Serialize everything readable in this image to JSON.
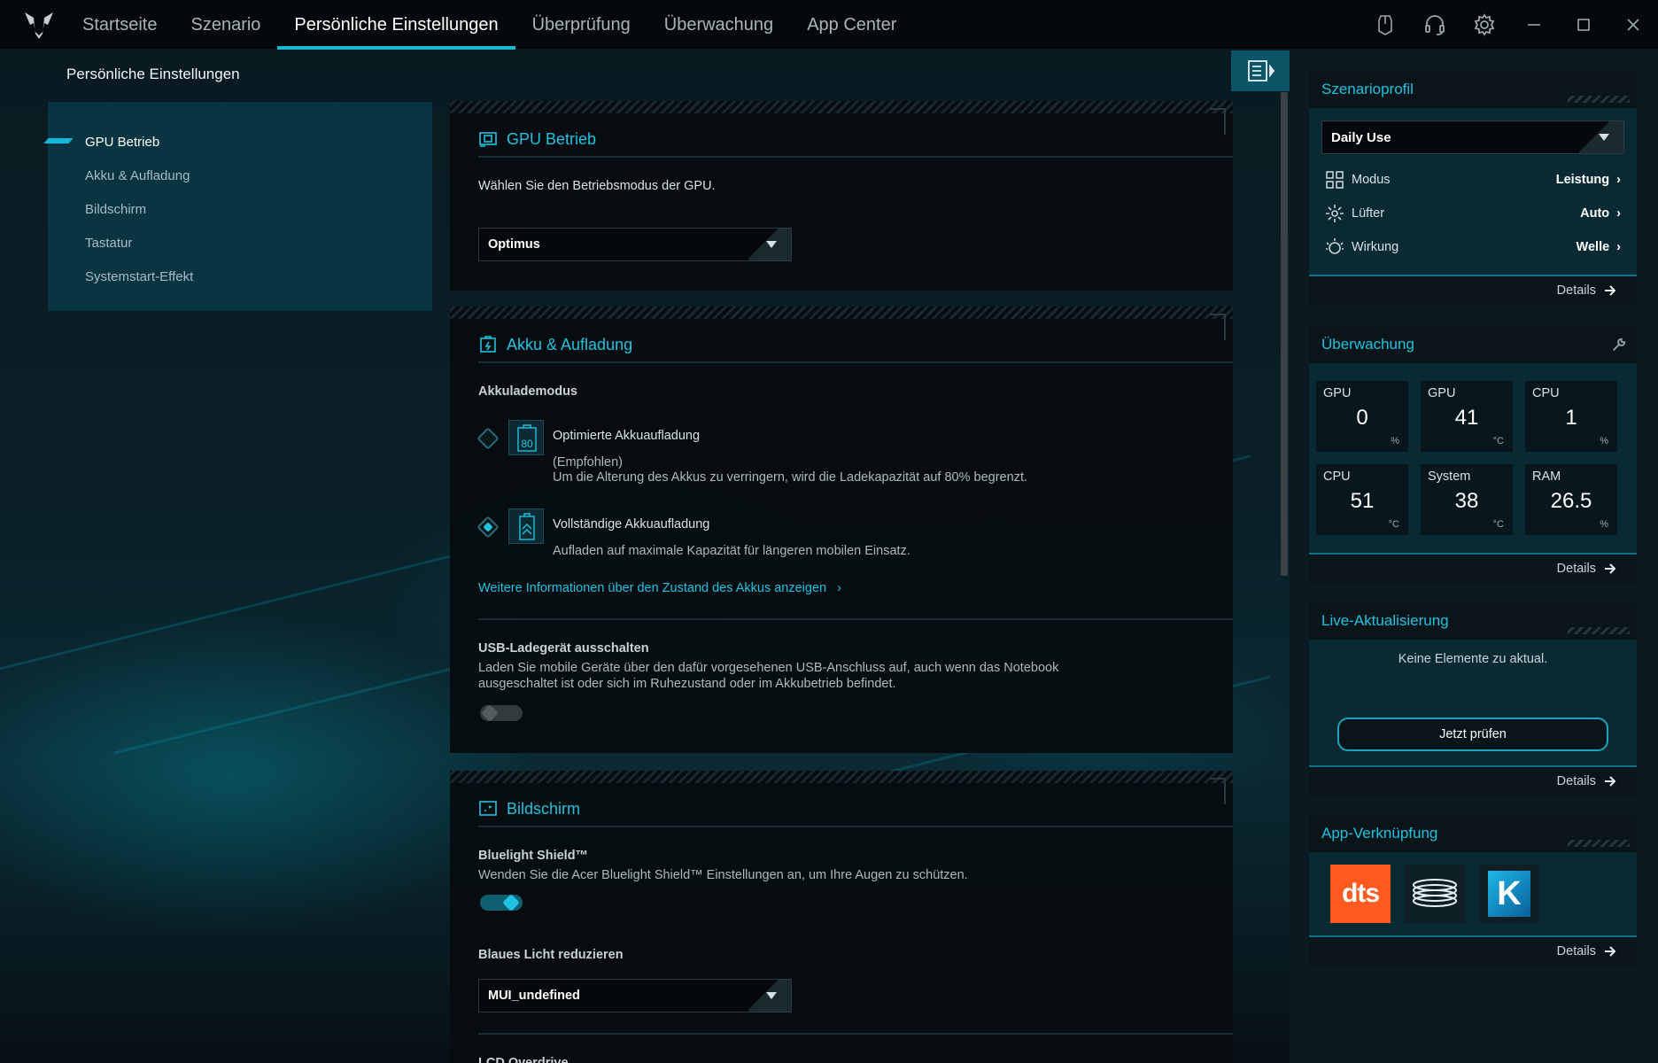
{
  "nav": {
    "tabs": [
      "Startseite",
      "Szenario",
      "Persönliche Einstellungen",
      "Überprüfung",
      "Überwachung",
      "App Center"
    ],
    "active_index": 2
  },
  "page": {
    "title": "Persönliche Einstellungen"
  },
  "side_menu": {
    "items": [
      "GPU Betrieb",
      "Akku & Aufladung",
      "Bildschirm",
      "Tastatur",
      "Systemstart-Effekt"
    ],
    "active_index": 0
  },
  "gpu_panel": {
    "title": "GPU Betrieb",
    "description": "Wählen Sie den Betriebsmodus der GPU.",
    "mode_value": "Optimus"
  },
  "battery_panel": {
    "title": "Akku & Aufladung",
    "mode_label": "Akkulademodus",
    "optimized": {
      "title": "Optimierte Akkuaufladung",
      "recommended": "(Empfohlen)",
      "description": "Um die Alterung des Akkus zu verringern, wird die Ladekapazität auf 80% begrenzt.",
      "icon_text": "80",
      "selected": false
    },
    "full": {
      "title": "Vollständige Akkuaufladung",
      "description": "Aufladen auf maximale Kapazität für längeren mobilen Einsatz.",
      "selected": true
    },
    "info_link": "Weitere Informationen über den Zustand des Akkus anzeigen",
    "usb": {
      "title": "USB-Ladegerät ausschalten",
      "description_line1": "Laden Sie mobile Geräte über den dafür vorgesehenen USB-Anschluss auf, auch wenn das Notebook",
      "description_line2": "ausgeschaltet ist oder sich im Ruhezustand oder im Akkubetrieb befindet.",
      "enabled": false
    }
  },
  "display_panel": {
    "title": "Bildschirm",
    "bluelight": {
      "title": "Bluelight Shield™",
      "description": "Wenden Sie die Acer Bluelight Shield™ Einstellungen an, um Ihre Augen zu schützen.",
      "enabled": true
    },
    "reduce_blue": {
      "title": "Blaues Licht reduzieren",
      "value": "MUI_undefined"
    },
    "next_item": "LCD Overdrive"
  },
  "right": {
    "details_label": "Details",
    "scenario": {
      "title": "Szenarioprofil",
      "profile": "Daily Use",
      "rows": [
        {
          "label": "Modus",
          "value": "Leistung",
          "icon": "grid-icon"
        },
        {
          "label": "Lüfter",
          "value": "Auto",
          "icon": "fan-icon"
        },
        {
          "label": "Wirkung",
          "value": "Welle",
          "icon": "lighting-icon"
        }
      ]
    },
    "monitoring": {
      "title": "Überwachung",
      "stats": [
        {
          "label": "GPU",
          "value": "0",
          "unit": "%"
        },
        {
          "label": "GPU",
          "value": "41",
          "unit": "°C"
        },
        {
          "label": "CPU",
          "value": "1",
          "unit": "%"
        },
        {
          "label": "CPU",
          "value": "51",
          "unit": "°C"
        },
        {
          "label": "System",
          "value": "38",
          "unit": "°C"
        },
        {
          "label": "RAM",
          "value": "26.5",
          "unit": "%"
        }
      ]
    },
    "live_update": {
      "title": "Live-Aktualisierung",
      "message": "Keine Elemente zu aktual.",
      "button": "Jetzt prüfen"
    },
    "app_shortcut": {
      "title": "App-Verknüpfung",
      "apps": [
        "dts",
        "coil-app",
        "K"
      ]
    }
  },
  "colors": {
    "accent": "#13b8d8",
    "panel": "#0a2a33",
    "background": "#05090c"
  }
}
